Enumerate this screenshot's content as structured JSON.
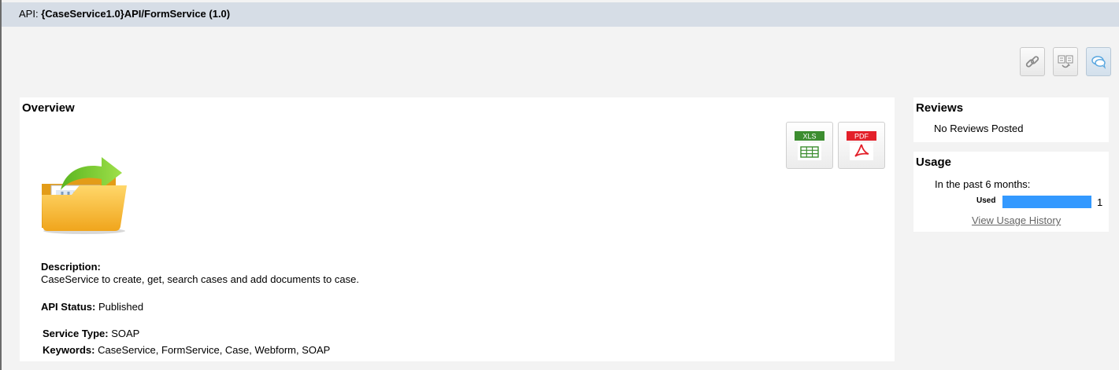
{
  "header": {
    "prefix": "API:",
    "api_name": "{CaseService1.0}API/FormService (1.0)"
  },
  "toolbar": {
    "buttons": [
      {
        "icon": "link-icon"
      },
      {
        "icon": "compare-icon"
      },
      {
        "icon": "comment-icon",
        "active": true
      }
    ]
  },
  "overview": {
    "title": "Overview",
    "exports": [
      {
        "label": "XLS",
        "color": "#3c8d2f",
        "icon": "spreadsheet-icon"
      },
      {
        "label": "PDF",
        "color": "#e3202a",
        "icon": "pdf-icon"
      }
    ],
    "description_label": "Description:",
    "description": "CaseService to create, get, search cases and add documents to case.",
    "api_status_label": "API Status:",
    "api_status": "Published",
    "service_type_label": "Service Type:",
    "service_type": "SOAP",
    "keywords_label": "Keywords:",
    "keywords": "CaseService, FormService, Case, Webform, SOAP"
  },
  "reviews": {
    "title": "Reviews",
    "empty_text": "No Reviews Posted"
  },
  "usage": {
    "title": "Usage",
    "period_text": "In the past 6 months:",
    "used_label": "Used",
    "used_count": "1",
    "bar_color": "#3399ff",
    "history_link": "View Usage History"
  }
}
